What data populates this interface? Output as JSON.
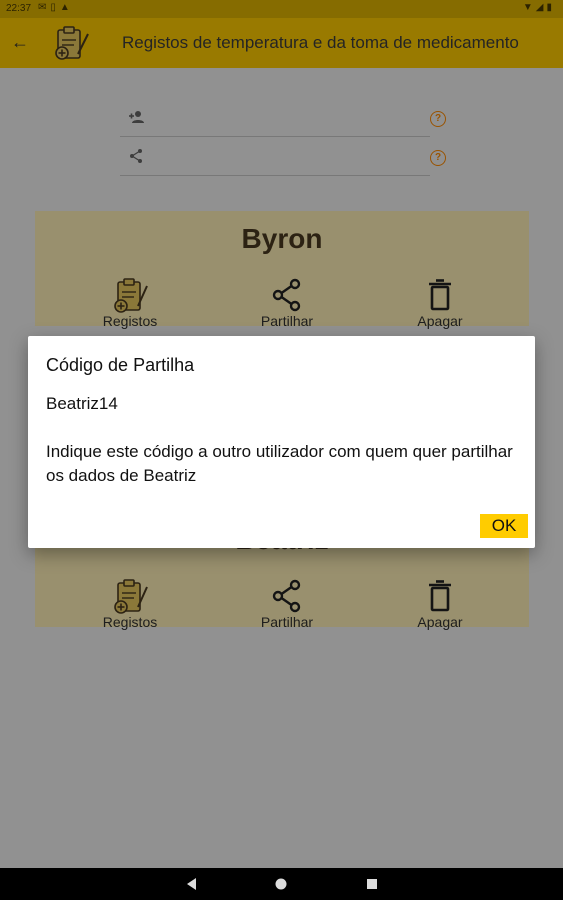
{
  "status_bar": {
    "time": "22:37",
    "left_icons": [
      "mail-icon",
      "battery-saver-icon",
      "warning-icon"
    ],
    "right_icons": [
      "wifi-icon",
      "signal-icon",
      "battery-icon"
    ]
  },
  "app_bar": {
    "title": "Registos de temperatura e da toma de medicamento",
    "back_icon": "arrow-left-icon",
    "logo": "clipboard-medical-icon"
  },
  "form": {
    "fields": [
      {
        "icon": "add-person-icon",
        "value": "",
        "help": "?"
      },
      {
        "icon": "share-icon",
        "value": "",
        "help": "?"
      }
    ]
  },
  "cards": [
    {
      "name": "Byron",
      "actions": [
        {
          "icon": "clipboard-medical-icon",
          "label": "Registos"
        },
        {
          "icon": "share-icon",
          "label": "Partilhar"
        },
        {
          "icon": "trash-icon",
          "label": "Apagar"
        }
      ]
    },
    {
      "name": "Beatriz",
      "actions": [
        {
          "icon": "clipboard-medical-icon",
          "label": "Registos"
        },
        {
          "icon": "share-icon",
          "label": "Partilhar"
        },
        {
          "icon": "trash-icon",
          "label": "Apagar"
        }
      ]
    }
  ],
  "dialog": {
    "title": "Código de Partilha",
    "code": "Beatriz14",
    "message": "Indique este código a outro utilizador com quem quer partilhar os dados de Beatriz",
    "ok_label": "OK"
  },
  "colors": {
    "app_bar": "#ffcc00",
    "card_bg": "#fff1b8",
    "help_icon": "#ff8a00",
    "ok_button": "#ffcc00"
  }
}
